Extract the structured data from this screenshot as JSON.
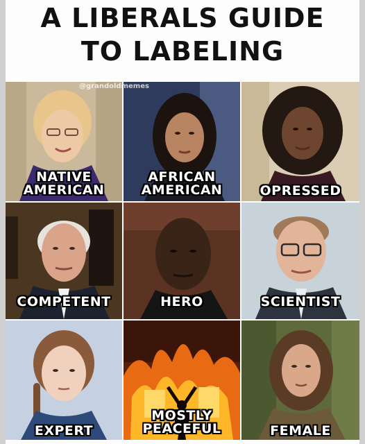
{
  "title_line1": "A LIBERALS GUIDE",
  "title_line2": "TO LABELING",
  "watermark": "@grandoldmemes",
  "panels": [
    {
      "lines": [
        "NATIVE",
        "AMERICAN"
      ],
      "bg": "#c9b89a",
      "subject": "woman-glasses-blonde"
    },
    {
      "lines": [
        "AFRICAN",
        "AMERICAN"
      ],
      "bg": "#2d3a5a",
      "subject": "woman-dark-hair"
    },
    {
      "lines": [
        "OPRESSED"
      ],
      "bg": "#d9cdb2",
      "subject": "woman-curly-hair"
    },
    {
      "lines": [
        "COMPETENT"
      ],
      "bg": "#4a3520",
      "subject": "older-man-suit"
    },
    {
      "lines": [
        "HERO"
      ],
      "bg": "#5a3222",
      "subject": "man-portrait"
    },
    {
      "lines": [
        "SCIENTIST"
      ],
      "bg": "#c7d1d8",
      "subject": "man-glasses"
    },
    {
      "lines": [
        "EXPERT"
      ],
      "bg": "#c4cfe0",
      "subject": "girl-braids"
    },
    {
      "lines": [
        "MOSTLY",
        "PEACEFUL"
      ],
      "bg": "#3a1408",
      "subject": "burning-building"
    },
    {
      "lines": [
        "FEMALE"
      ],
      "bg": "#5f6b3e",
      "subject": "person-long-hair"
    }
  ],
  "colors": {
    "label_fill": "#ffffff",
    "label_outline": "#000000",
    "title": "#111111"
  }
}
